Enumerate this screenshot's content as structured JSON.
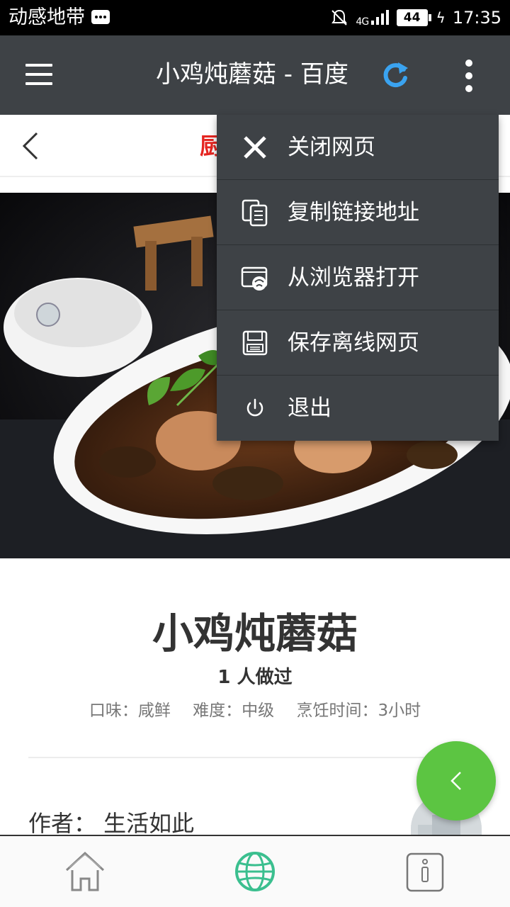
{
  "status_bar": {
    "carrier": "动感地带",
    "signal": "4G",
    "battery": "44",
    "time": "17:35"
  },
  "app_bar": {
    "title": "小鸡炖蘑菇 - 百度",
    "refresh_color": "#3aa3f0"
  },
  "sub_header": {
    "title_partial": "厨"
  },
  "recipe": {
    "title": "小鸡炖蘑菇",
    "made_count": "1 人做过",
    "flavor": "口味：咸鲜",
    "difficulty": "难度：中级",
    "cook_time": "烹饪时间：3小时",
    "author": "作者：  生活如此"
  },
  "menu": {
    "items": [
      {
        "label": "关闭网页",
        "icon": "close-icon"
      },
      {
        "label": "复制链接地址",
        "icon": "copy-link-icon"
      },
      {
        "label": "从浏览器打开",
        "icon": "open-browser-icon"
      },
      {
        "label": "保存离线网页",
        "icon": "save-offline-icon"
      },
      {
        "label": "退出",
        "icon": "power-icon"
      }
    ]
  },
  "bottom_nav": {
    "items": [
      "home-icon",
      "globe-icon",
      "info-icon"
    ],
    "active_color": "#3bbf8f"
  },
  "colors": {
    "header_bg": "#3e4246",
    "fab": "#5cc542",
    "accent_red": "#e52521"
  }
}
